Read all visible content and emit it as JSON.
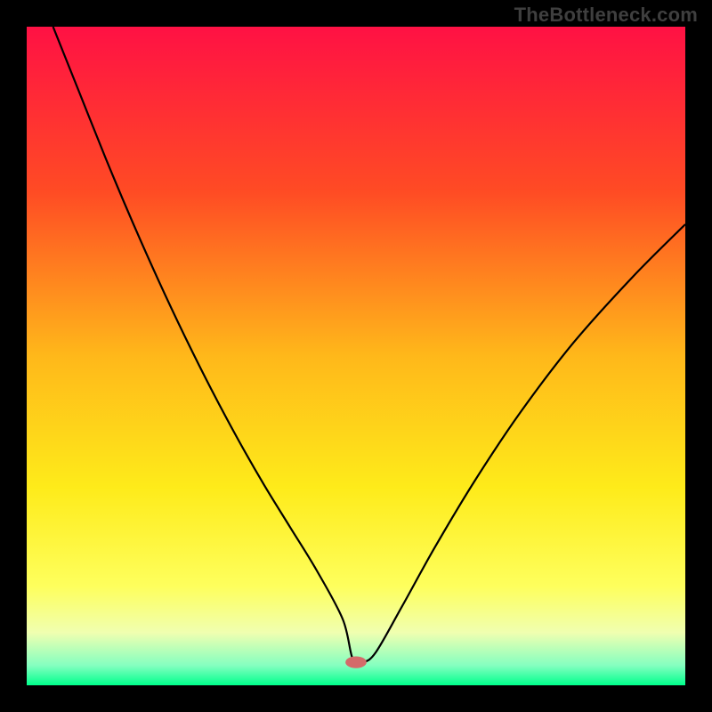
{
  "watermark": "TheBottleneck.com",
  "chart_data": {
    "type": "line",
    "title": "",
    "xlabel": "",
    "ylabel": "",
    "xlim": [
      0,
      100
    ],
    "ylim": [
      0,
      100
    ],
    "background_gradient": {
      "orientation": "vertical",
      "stops": [
        {
          "offset": 0.0,
          "color": "#ff1144"
        },
        {
          "offset": 0.25,
          "color": "#ff4b24"
        },
        {
          "offset": 0.5,
          "color": "#ffb81a"
        },
        {
          "offset": 0.7,
          "color": "#feeb1a"
        },
        {
          "offset": 0.85,
          "color": "#feff5d"
        },
        {
          "offset": 0.92,
          "color": "#f0ffb0"
        },
        {
          "offset": 0.97,
          "color": "#84ffc0"
        },
        {
          "offset": 1.0,
          "color": "#00ff8c"
        }
      ]
    },
    "series": [
      {
        "name": "bottleneck-curve",
        "color": "#000000",
        "x": [
          4,
          8,
          12,
          16,
          20,
          24,
          28,
          32,
          36,
          40,
          44,
          48,
          49.5,
          51,
          53,
          57,
          62,
          68,
          75,
          83,
          92,
          100
        ],
        "y": [
          100,
          90,
          80,
          70.5,
          61.5,
          53,
          45,
          37.5,
          30.5,
          24,
          17.5,
          10,
          4,
          3.5,
          5,
          12,
          21,
          31,
          41.5,
          52,
          62,
          70
        ]
      }
    ],
    "marker": {
      "name": "sweet-spot",
      "x": 50,
      "y": 3.5,
      "rx": 1.6,
      "ry": 0.9,
      "color": "#d46a6a"
    }
  }
}
